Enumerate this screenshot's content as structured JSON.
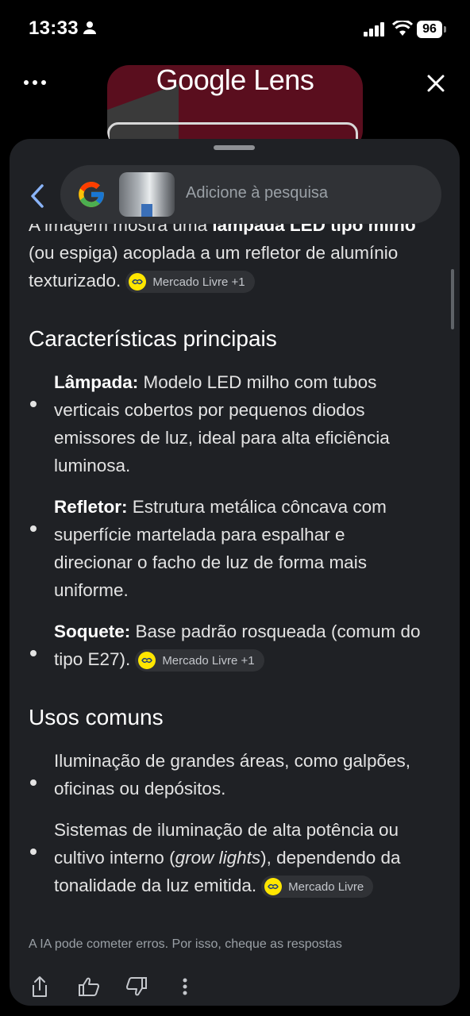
{
  "status": {
    "time": "13:33",
    "battery": "96"
  },
  "header": {
    "title": "Google Lens"
  },
  "search": {
    "placeholder": "Adicione à pesquisa"
  },
  "content": {
    "intro_partial_prefix": "A imagem mostra uma ",
    "intro_partial_bold": "lâmpada LED tipo milho",
    "intro_line2": "(ou espiga) acoplada a um refletor de alumínio",
    "intro_line3": "texturizado.",
    "section1_title": "Características principais",
    "section2_title": "Usos comuns",
    "bullets1": [
      {
        "label": "Lâmpada:",
        "text1": " Modelo LED milho com tubos",
        "text2": "verticais cobertos por pequenos diodos",
        "text3": "emissores de luz, ideal para alta eficiência",
        "text4": "luminosa."
      },
      {
        "label": "Refletor:",
        "text1": " Estrutura metálica côncava com",
        "text2": "superfície martelada para espalhar e",
        "text3": "direcionar o facho de luz de forma mais",
        "text4": "uniforme."
      },
      {
        "label": "Soquete:",
        "text1": " Base padrão rosqueada (comum do",
        "text2": "tipo E27)."
      }
    ],
    "bullets2": [
      {
        "text1": "Iluminação de grandes áreas, como galpões,",
        "text2": "oficinas ou depósitos."
      },
      {
        "text1": "Sistemas de iluminação de alta potência ou",
        "text2_a": "cultivo interno (",
        "text2_italic": "grow lights",
        "text2_b": "), dependendo da",
        "text3": "tonalidade da luz emitida."
      }
    ],
    "chips": {
      "intro": "Mercado Livre +1",
      "soquete": "Mercado Livre +1",
      "sistemas": "Mercado Livre"
    }
  },
  "footer": {
    "disclaimer": "A IA pode cometer erros. Por isso, cheque as respostas"
  },
  "colors": {
    "sheet": "#1f2125",
    "pill": "#303236",
    "accent_back": "#8ab4f8",
    "chip_icon": "#ffe600"
  },
  "icons": [
    "person-icon",
    "signal-icon",
    "wifi-icon",
    "more-icon",
    "close-icon",
    "back-arrow-icon",
    "google-g-icon",
    "handshake-icon",
    "share-icon",
    "thumbs-up-icon",
    "thumbs-down-icon",
    "more-vert-icon"
  ]
}
